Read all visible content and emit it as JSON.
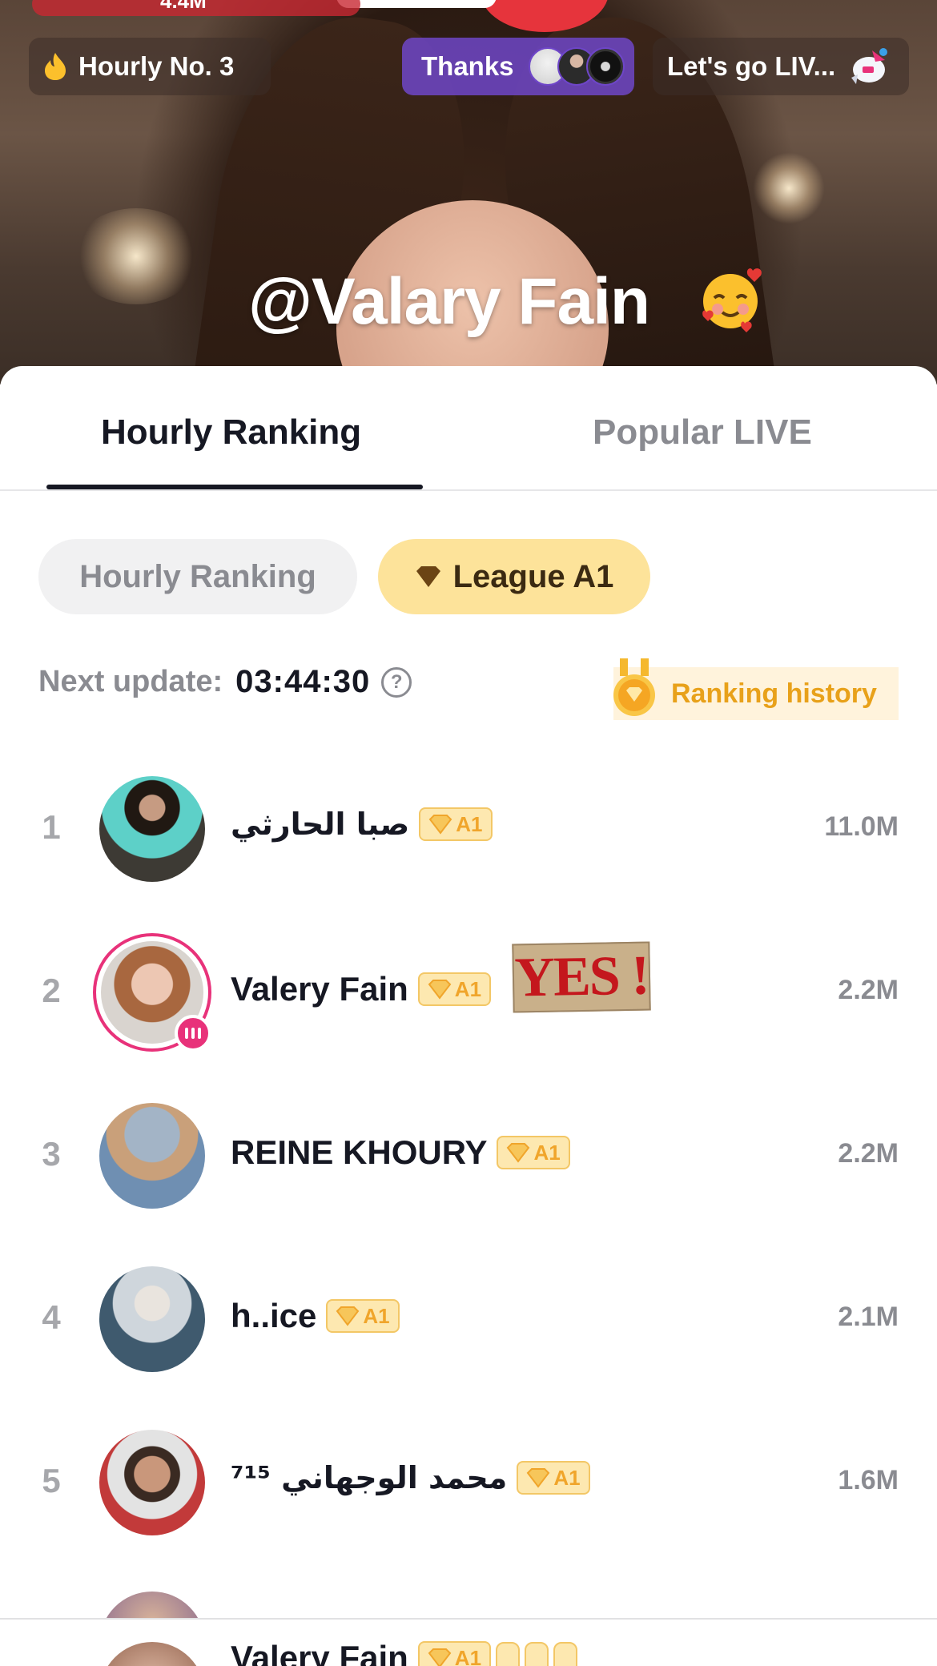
{
  "live": {
    "top_count": "4.4M",
    "hourly_pill": "Hourly No. 3",
    "thanks_pill": "Thanks",
    "golive_pill": "Let's go LIV...",
    "host_handle": "@Valary Fain",
    "emoji": "smiling-face-with-hearts"
  },
  "tabs": [
    {
      "label": "Hourly Ranking",
      "active": true
    },
    {
      "label": "Popular LIVE",
      "active": false
    }
  ],
  "chips": {
    "hourly": "Hourly Ranking",
    "league": "League A1"
  },
  "update": {
    "label": "Next update:",
    "time": "03:44:30",
    "help": "?"
  },
  "history": {
    "label": "Ranking history"
  },
  "ranking": [
    {
      "rank": "1",
      "name": "صبا الحارثي",
      "league": "A1",
      "value": "11.0M",
      "live": false
    },
    {
      "rank": "2",
      "name": "Valery Fain",
      "league": "A1",
      "value": "2.2M",
      "live": true,
      "sticker": "YES !"
    },
    {
      "rank": "3",
      "name": "REINE KHOURY",
      "league": "A1",
      "value": "2.2M",
      "live": false
    },
    {
      "rank": "4",
      "name": "h..ice",
      "league": "A1",
      "value": "2.1M",
      "live": false
    },
    {
      "rank": "5",
      "name": "محمد الوجهاني ⁷¹⁵",
      "league": "A1",
      "value": "1.6M",
      "live": false
    }
  ],
  "current_user": {
    "name": "Valery Fain",
    "league": "A1"
  },
  "colors": {
    "accent_live": "#e8327a",
    "league_gold": "#f0a52b",
    "chip_league_bg": "#fde39a",
    "thanks_purple": "#6e46c8"
  }
}
